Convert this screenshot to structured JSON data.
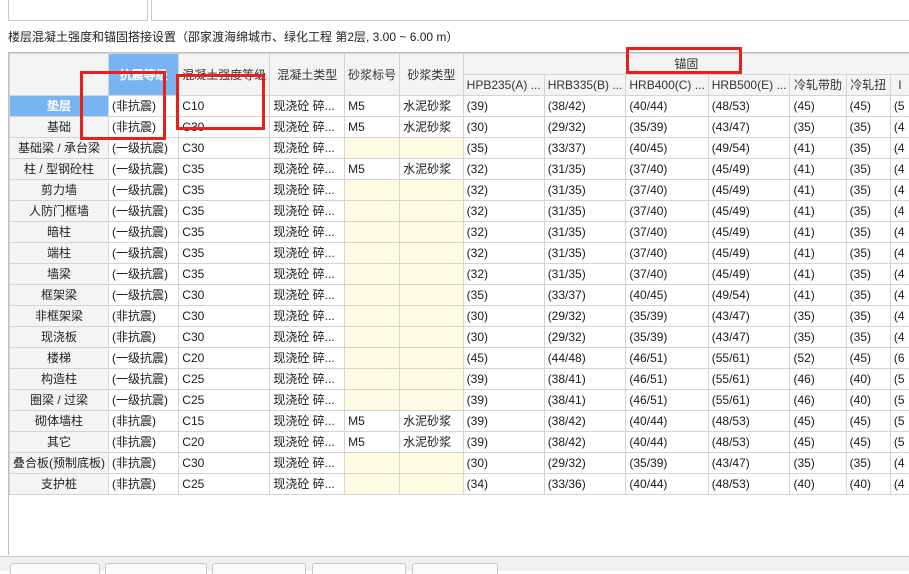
{
  "title": "楼层混凝土强度和锚固搭接设置（邵家渡海绵城市、绿化工程  第2层, 3.00 ~ 6.00 m）",
  "headers": {
    "seismic": "抗震等级",
    "concrete_grade": "混凝土强度等级",
    "concrete_type": "混凝土类型",
    "mortar_grade": "砂浆标号",
    "mortar_type": "砂浆类型",
    "anchorage_group": "锚固",
    "hpb235": "HPB235(A) ...",
    "hrb335": "HRB335(B) ...",
    "hrb400": "HRB400(C) ...",
    "hrb500": "HRB500(E) ...",
    "cold_ribbed": "冷轧带肋",
    "cold_twisted": "冷轧扭",
    "extra": "I"
  },
  "rows": [
    {
      "name": "垫层",
      "seismic": "(非抗震)",
      "grade": "C10",
      "ctype": "现浇砼 碎...",
      "mortar_grade": "M5",
      "mortar_type": "水泥砂浆",
      "hpb": "(39)",
      "hrb335": "(38/42)",
      "hrb400": "(40/44)",
      "hrb500": "(48/53)",
      "cold_ribbed": "(45)",
      "cold_twisted": "(45)",
      "extra": "(5"
    },
    {
      "name": "基础",
      "seismic": "(非抗震)",
      "grade": "C30",
      "ctype": "现浇砼 碎...",
      "mortar_grade": "M5",
      "mortar_type": "水泥砂浆",
      "hpb": "(30)",
      "hrb335": "(29/32)",
      "hrb400": "(35/39)",
      "hrb500": "(43/47)",
      "cold_ribbed": "(35)",
      "cold_twisted": "(35)",
      "extra": "(4"
    },
    {
      "name": "基础梁 / 承台梁",
      "seismic": "(一级抗震)",
      "grade": "C30",
      "ctype": "现浇砼 碎...",
      "mortar_grade": "",
      "mortar_type": "",
      "hpb": "(35)",
      "hrb335": "(33/37)",
      "hrb400": "(40/45)",
      "hrb500": "(49/54)",
      "cold_ribbed": "(41)",
      "cold_twisted": "(35)",
      "extra": "(4"
    },
    {
      "name": "柱 / 型钢砼柱",
      "seismic": "(一级抗震)",
      "grade": "C35",
      "ctype": "现浇砼 碎...",
      "mortar_grade": "M5",
      "mortar_type": "水泥砂浆",
      "hpb": "(32)",
      "hrb335": "(31/35)",
      "hrb400": "(37/40)",
      "hrb500": "(45/49)",
      "cold_ribbed": "(41)",
      "cold_twisted": "(35)",
      "extra": "(4"
    },
    {
      "name": "剪力墙",
      "seismic": "(一级抗震)",
      "grade": "C35",
      "ctype": "现浇砼 碎...",
      "mortar_grade": "",
      "mortar_type": "",
      "hpb": "(32)",
      "hrb335": "(31/35)",
      "hrb400": "(37/40)",
      "hrb500": "(45/49)",
      "cold_ribbed": "(41)",
      "cold_twisted": "(35)",
      "extra": "(4"
    },
    {
      "name": "人防门框墙",
      "seismic": "(一级抗震)",
      "grade": "C35",
      "ctype": "现浇砼 碎...",
      "mortar_grade": "",
      "mortar_type": "",
      "hpb": "(32)",
      "hrb335": "(31/35)",
      "hrb400": "(37/40)",
      "hrb500": "(45/49)",
      "cold_ribbed": "(41)",
      "cold_twisted": "(35)",
      "extra": "(4"
    },
    {
      "name": "暗柱",
      "seismic": "(一级抗震)",
      "grade": "C35",
      "ctype": "现浇砼 碎...",
      "mortar_grade": "",
      "mortar_type": "",
      "hpb": "(32)",
      "hrb335": "(31/35)",
      "hrb400": "(37/40)",
      "hrb500": "(45/49)",
      "cold_ribbed": "(41)",
      "cold_twisted": "(35)",
      "extra": "(4"
    },
    {
      "name": "端柱",
      "seismic": "(一级抗震)",
      "grade": "C35",
      "ctype": "现浇砼 碎...",
      "mortar_grade": "",
      "mortar_type": "",
      "hpb": "(32)",
      "hrb335": "(31/35)",
      "hrb400": "(37/40)",
      "hrb500": "(45/49)",
      "cold_ribbed": "(41)",
      "cold_twisted": "(35)",
      "extra": "(4"
    },
    {
      "name": "墙梁",
      "seismic": "(一级抗震)",
      "grade": "C35",
      "ctype": "现浇砼 碎...",
      "mortar_grade": "",
      "mortar_type": "",
      "hpb": "(32)",
      "hrb335": "(31/35)",
      "hrb400": "(37/40)",
      "hrb500": "(45/49)",
      "cold_ribbed": "(41)",
      "cold_twisted": "(35)",
      "extra": "(4"
    },
    {
      "name": "框架梁",
      "seismic": "(一级抗震)",
      "grade": "C30",
      "ctype": "现浇砼 碎...",
      "mortar_grade": "",
      "mortar_type": "",
      "hpb": "(35)",
      "hrb335": "(33/37)",
      "hrb400": "(40/45)",
      "hrb500": "(49/54)",
      "cold_ribbed": "(41)",
      "cold_twisted": "(35)",
      "extra": "(4"
    },
    {
      "name": "非框架梁",
      "seismic": "(非抗震)",
      "grade": "C30",
      "ctype": "现浇砼 碎...",
      "mortar_grade": "",
      "mortar_type": "",
      "hpb": "(30)",
      "hrb335": "(29/32)",
      "hrb400": "(35/39)",
      "hrb500": "(43/47)",
      "cold_ribbed": "(35)",
      "cold_twisted": "(35)",
      "extra": "(4"
    },
    {
      "name": "现浇板",
      "seismic": "(非抗震)",
      "grade": "C30",
      "ctype": "现浇砼 碎...",
      "mortar_grade": "",
      "mortar_type": "",
      "hpb": "(30)",
      "hrb335": "(29/32)",
      "hrb400": "(35/39)",
      "hrb500": "(43/47)",
      "cold_ribbed": "(35)",
      "cold_twisted": "(35)",
      "extra": "(4"
    },
    {
      "name": "楼梯",
      "seismic": "(一级抗震)",
      "grade": "C20",
      "ctype": "现浇砼 碎...",
      "mortar_grade": "",
      "mortar_type": "",
      "hpb": "(45)",
      "hrb335": "(44/48)",
      "hrb400": "(46/51)",
      "hrb500": "(55/61)",
      "cold_ribbed": "(52)",
      "cold_twisted": "(45)",
      "extra": "(6"
    },
    {
      "name": "构造柱",
      "seismic": "(一级抗震)",
      "grade": "C25",
      "ctype": "现浇砼 碎...",
      "mortar_grade": "",
      "mortar_type": "",
      "hpb": "(39)",
      "hrb335": "(38/41)",
      "hrb400": "(46/51)",
      "hrb500": "(55/61)",
      "cold_ribbed": "(46)",
      "cold_twisted": "(40)",
      "extra": "(5"
    },
    {
      "name": "圈梁 / 过梁",
      "seismic": "(一级抗震)",
      "grade": "C25",
      "ctype": "现浇砼 碎...",
      "mortar_grade": "",
      "mortar_type": "",
      "hpb": "(39)",
      "hrb335": "(38/41)",
      "hrb400": "(46/51)",
      "hrb500": "(55/61)",
      "cold_ribbed": "(46)",
      "cold_twisted": "(40)",
      "extra": "(5"
    },
    {
      "name": "砌体墙柱",
      "seismic": "(非抗震)",
      "grade": "C15",
      "ctype": "现浇砼 碎...",
      "mortar_grade": "M5",
      "mortar_type": "水泥砂浆",
      "hpb": "(39)",
      "hrb335": "(38/42)",
      "hrb400": "(40/44)",
      "hrb500": "(48/53)",
      "cold_ribbed": "(45)",
      "cold_twisted": "(45)",
      "extra": "(5"
    },
    {
      "name": "其它",
      "seismic": "(非抗震)",
      "grade": "C20",
      "ctype": "现浇砼 碎...",
      "mortar_grade": "M5",
      "mortar_type": "水泥砂浆",
      "hpb": "(39)",
      "hrb335": "(38/42)",
      "hrb400": "(40/44)",
      "hrb500": "(48/53)",
      "cold_ribbed": "(45)",
      "cold_twisted": "(45)",
      "extra": "(5"
    },
    {
      "name": "叠合板(预制底板)",
      "seismic": "(非抗震)",
      "grade": "C30",
      "ctype": "现浇砼 碎...",
      "mortar_grade": "",
      "mortar_type": "",
      "hpb": "(30)",
      "hrb335": "(29/32)",
      "hrb400": "(35/39)",
      "hrb500": "(43/47)",
      "cold_ribbed": "(35)",
      "cold_twisted": "(35)",
      "extra": "(4"
    },
    {
      "name": "支护桩",
      "seismic": "(非抗震)",
      "grade": "C25",
      "ctype": "现浇砼 碎...",
      "mortar_grade": "",
      "mortar_type": "",
      "hpb": "(34)",
      "hrb335": "(33/36)",
      "hrb400": "(40/44)",
      "hrb500": "(48/53)",
      "cold_ribbed": "(40)",
      "cold_twisted": "(40)",
      "extra": "(4"
    }
  ],
  "colors": {
    "selection": "#79b4f2",
    "highlight_border": "#e8201c",
    "empty_cell": "#fefbe2",
    "header_bg": "#f4f4f4"
  }
}
